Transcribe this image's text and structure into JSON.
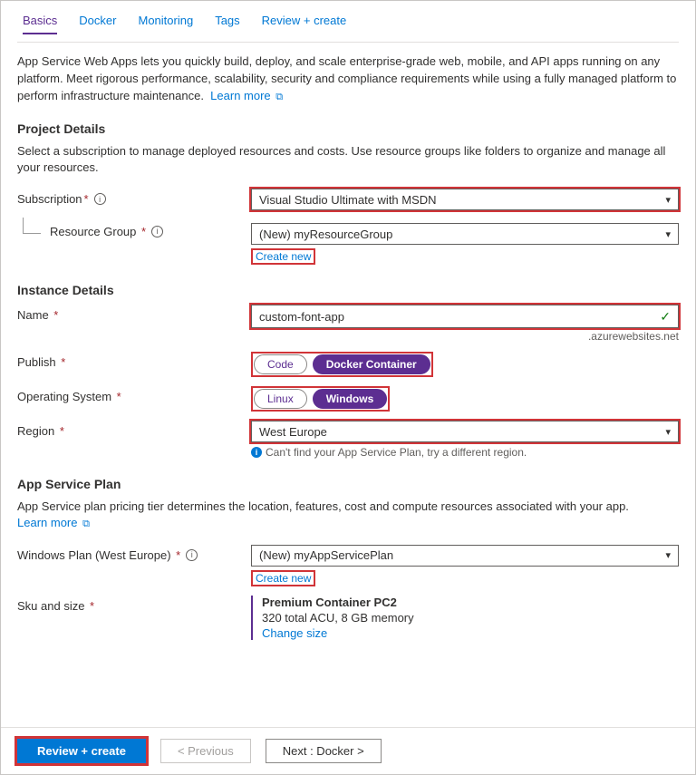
{
  "tabs": {
    "t0": "Basics",
    "t1": "Docker",
    "t2": "Monitoring",
    "t3": "Tags",
    "t4": "Review + create"
  },
  "intro": {
    "text": "App Service Web Apps lets you quickly build, deploy, and scale enterprise-grade web, mobile, and API apps running on any platform. Meet rigorous performance, scalability, security and compliance requirements while using a fully managed platform to perform infrastructure maintenance.",
    "learn_more": "Learn more"
  },
  "project": {
    "heading": "Project Details",
    "desc": "Select a subscription to manage deployed resources and costs. Use resource groups like folders to organize and manage all your resources.",
    "subscription_label": "Subscription",
    "subscription_value": "Visual Studio Ultimate with MSDN",
    "rg_label": "Resource Group",
    "rg_value": "(New) myResourceGroup",
    "create_new": "Create new"
  },
  "instance": {
    "heading": "Instance Details",
    "name_label": "Name",
    "name_value": "custom-font-app",
    "name_suffix": ".azurewebsites.net",
    "publish_label": "Publish",
    "publish_opt1": "Code",
    "publish_opt2": "Docker Container",
    "os_label": "Operating System",
    "os_opt1": "Linux",
    "os_opt2": "Windows",
    "region_label": "Region",
    "region_value": "West Europe",
    "region_help": "Can't find your App Service Plan, try a different region."
  },
  "plan": {
    "heading": "App Service Plan",
    "desc": "App Service plan pricing tier determines the location, features, cost and compute resources associated with your app.",
    "learn_more": "Learn more",
    "plan_label": "Windows Plan (West Europe)",
    "plan_value": "(New) myAppServicePlan",
    "create_new": "Create new",
    "sku_label": "Sku and size",
    "sku_title": "Premium Container PC2",
    "sku_detail": "320 total ACU, 8 GB memory",
    "change_size": "Change size"
  },
  "footer": {
    "primary": "Review + create",
    "prev": "< Previous",
    "next": "Next : Docker >"
  }
}
